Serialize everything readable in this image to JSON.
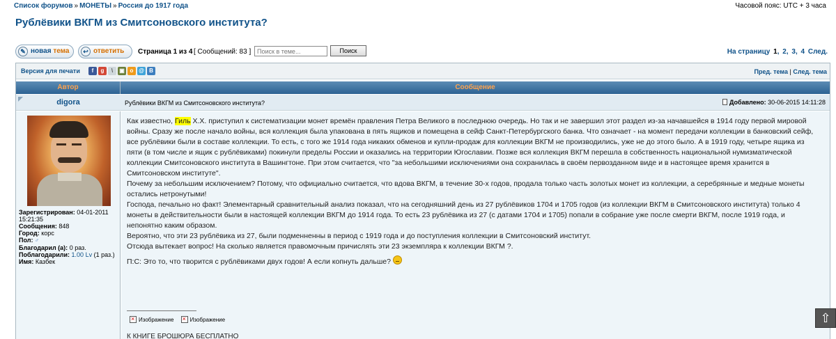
{
  "breadcrumb": {
    "items": [
      "Список форумов",
      "МОНЕТЫ",
      "Россия до 1917 года"
    ],
    "separator": "»",
    "timezone": "Часовой пояс: UTC + 3 часа"
  },
  "topic": {
    "title": "Рублёвики ВКГМ из Смитсоновского института?"
  },
  "toolbar": {
    "new_topic_a": "новая ",
    "new_topic_b": "тема",
    "reply": "ответить",
    "page_info": "Страница 1 из 4",
    "posts_count": "[ Сообщений: 83 ]",
    "search_placeholder": "Поиск в теме...",
    "search_button": "Поиск",
    "pagination_label": "На страницу",
    "pages": [
      "1",
      "2",
      "3",
      "4"
    ],
    "next": "След."
  },
  "print_row": {
    "print_link": "Версия для печати",
    "share_icons": [
      "facebook-icon",
      "googleplus-icon",
      "twitter-icon",
      "vk-icon",
      "odnoklassniki-icon",
      "mailru-icon",
      "livejournal-icon"
    ],
    "prev_topic": "Пред. тема",
    "next_topic": "След. тема",
    "nav_sep": "|"
  },
  "table_header": {
    "author": "Автор",
    "message": "Сообщение"
  },
  "post": {
    "author": "digora",
    "subject": "Рублёвики ВКГМ из Смитсоновского института?",
    "added_label": "Добавлено:",
    "added_date": "30-06-2015 14:11:28",
    "profile": {
      "registered_label": "Зарегистрирован:",
      "registered_value": "04-01-2011 15:21:35",
      "posts_label": "Сообщения:",
      "posts_value": "848",
      "city_label": "Город:",
      "city_value": "корс",
      "gender_label": "Пол:",
      "thanked_label": "Благодарил (а):",
      "thanked_value": "0 раз.",
      "thanked_by_label": "Поблагодарили:",
      "thanked_by_value": "1.00 Lv",
      "thanked_by_count": "(1 раз.)",
      "name_label": "Имя:",
      "name_value": "Казбек"
    },
    "body": {
      "p1_before": "Как известно, ",
      "p1_highlight": "Гиль",
      "p1_after": " Х.Х. приступил к систематизации монет времён правления Петра Великого в последнюю очередь. Но так и не завершил этот раздел из-за начавшейся в 1914 году первой мировой войны. Сразу же после начало войны, вся коллекция была упакована в пять ящиков и помещена в сейф Санкт-Петербургского банка. Что означает - на момент передачи коллекции в банковский сейф, все рублёвики были в составе коллекции. То есть, с того же 1914 года никаких обменов и купли-продаж для коллекции ВКГМ не производились, уже не до этого было. А в 1919 году, четыре ящика из пяти (в том числе и ящик с рублёвиками) покинули пределы России и оказались на территории Югославии. Позже вся коллекция ВКГМ перешла в собственность национальной нумизматической коллекции Смитсоновского института в Вашингтоне. При этом считается, что \"за небольшими исключениями она сохранилась в своём первозданном виде и в настоящее время хранится в Смитсоновском институте\".",
      "p2": "Почему за небольшим исключением? Потому, что официально считается, что вдова ВКГМ, в течение 30-х годов, продала только часть золотых монет из коллекции, а серебрянные и медные монеты остались нетронутыми!",
      "p3": "Господа, печально но факт! Элементарный сравнительный анализ показал, что на сегодняшний день из 27 рублёвиков 1704 и 1705 годов (из коллекции ВКГМ в Смитсоновского института) только 4 монеты в действительности были в настоящей коллекции ВКГМ до 1914 года. То есть 23 рублёвика из 27 (с датами 1704 и 1705) попали в собрание уже после смерти ВКГМ, после 1919 года, и непонятно каким образом.",
      "p4": "Вероятно, что эти 23 рублёвика из 27, были подменненны в период с 1919 года и до поступления коллекции в Смитсоновский институт.",
      "p5": "Отсюда вытекает вопрос! На сколько является правомочным причислять эти 23 экземпляра к коллекции ВКГМ ?.",
      "p6": "П:С: Это то, что творится с рублёвиками двух годов! А если копнуть дальше?"
    },
    "signature": {
      "image1": "Изображение",
      "image2": "Изображение",
      "text": "К КНИГЕ БРОШЮРА БЕСПЛАТНО"
    }
  },
  "scroll_top": "⇧"
}
